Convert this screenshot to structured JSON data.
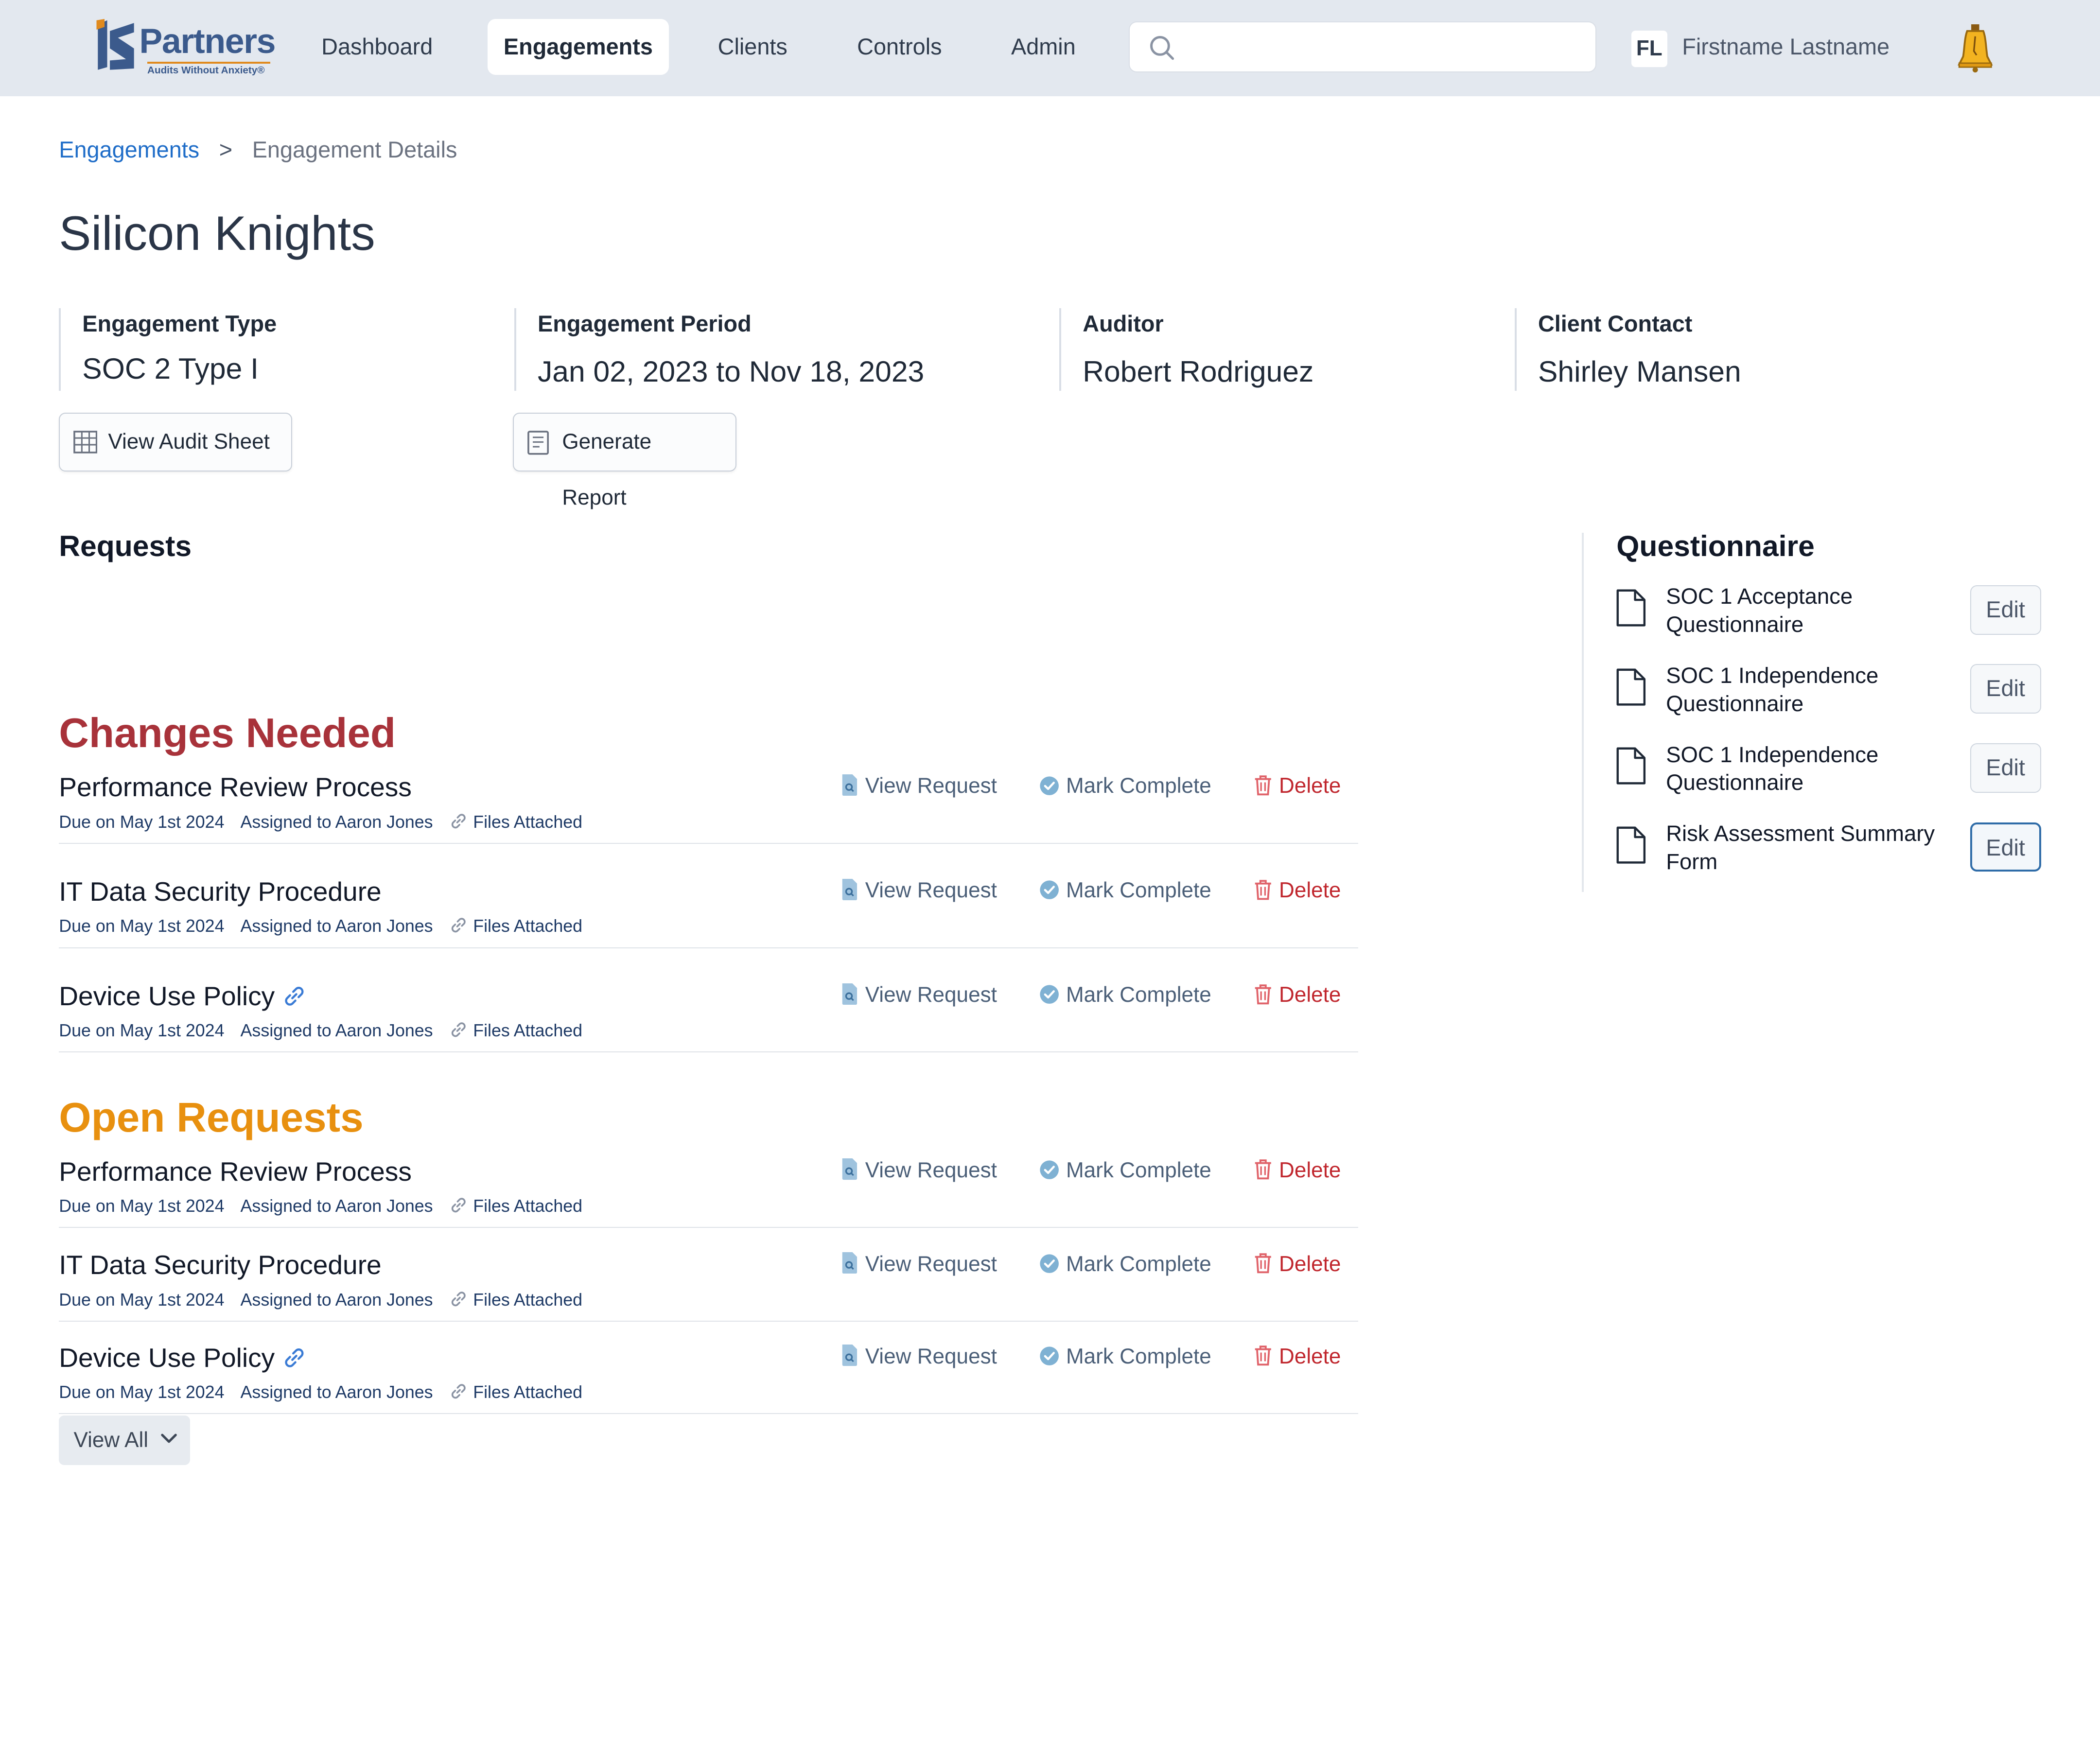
{
  "brand": {
    "name": "Partners",
    "tagline": "Audits Without Anxiety®",
    "accent": "#e08a1e",
    "primary": "#3b5a8c"
  },
  "nav": {
    "items": [
      {
        "label": "Dashboard"
      },
      {
        "label": "Engagements",
        "active": true
      },
      {
        "label": "Clients"
      },
      {
        "label": "Controls"
      },
      {
        "label": "Admin"
      }
    ]
  },
  "search": {
    "value": "",
    "placeholder": ""
  },
  "user": {
    "initials": "FL",
    "name": "Firstname Lastname"
  },
  "breadcrumb": {
    "parent": "Engagements",
    "separator": ">",
    "current": "Engagement Details"
  },
  "page": {
    "title": "Silicon Knights"
  },
  "engagement": {
    "type_label": "Engagement Type",
    "type_value": "SOC 2 Type I",
    "period_label": "Engagement Period",
    "period_value": "Jan 02, 2023 to Nov 18, 2023",
    "auditor_label": "Auditor",
    "auditor_value": "Robert Rodriguez",
    "contact_label": "Client Contact",
    "contact_value": "Shirley Mansen"
  },
  "buttons": {
    "audit_sheet": "View Audit Sheet",
    "generate_report": "Generate Report",
    "view_all": "View All"
  },
  "requests": {
    "title": "Requests",
    "actions": {
      "view": "View Request",
      "complete": "Mark Complete",
      "delete": "Delete"
    },
    "changes_needed": {
      "title": "Changes Needed",
      "color": "#a8323a",
      "items": [
        {
          "name": "Performance Review Process",
          "due": "Due on May 1st 2024",
          "assigned": "Assigned to Aaron Jones",
          "files": "Files Attached"
        },
        {
          "name": "IT Data Security Procedure",
          "due": "Due on May 1st 2024",
          "assigned": "Assigned to Aaron Jones",
          "files": "Files Attached"
        },
        {
          "name": "Device Use Policy",
          "due": "Due on May 1st 2024",
          "assigned": "Assigned to Aaron Jones",
          "files": "Files Attached",
          "linked": true
        }
      ]
    },
    "open": {
      "title": "Open Requests",
      "color": "#e8900f",
      "items": [
        {
          "name": "Performance Review Process",
          "due": "Due on May 1st 2024",
          "assigned": "Assigned to Aaron Jones",
          "files": "Files Attached"
        },
        {
          "name": "IT Data Security Procedure",
          "due": "Due on May 1st 2024",
          "assigned": "Assigned to Aaron Jones",
          "files": "Files Attached"
        },
        {
          "name": "Device Use Policy",
          "due": "Due on May 1st 2024",
          "assigned": "Assigned to Aaron Jones",
          "files": "Files Attached",
          "linked": true
        }
      ]
    }
  },
  "questionnaire": {
    "title": "Questionnaire",
    "edit_label": "Edit",
    "items": [
      {
        "label": "SOC 1 Acceptance Questionnaire"
      },
      {
        "label": "SOC 1 Independence Questionnaire"
      },
      {
        "label": "SOC 1 Independence Questionnaire"
      },
      {
        "label": "Risk Assessment Summary Form",
        "focused": true
      }
    ]
  },
  "icons": {
    "search": "search-icon",
    "bell": "liberty-bell-icon",
    "sheet": "table-icon",
    "report": "document-icon",
    "view": "file-search-icon",
    "complete": "check-circle-icon",
    "delete": "trash-icon",
    "files": "paperclip-link-icon",
    "link": "link-icon",
    "doc": "document-outline-icon",
    "chevron": "chevron-down-icon"
  }
}
